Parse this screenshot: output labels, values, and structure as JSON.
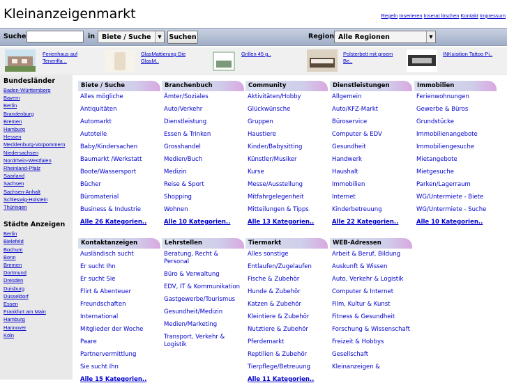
{
  "header": {
    "title": "Kleinanzeigenmarkt",
    "links": [
      "Regeln",
      "Inserieren",
      "Inserat löschen",
      "Kontakt",
      "Impressum"
    ]
  },
  "search": {
    "label": "Suche",
    "in_label": "in",
    "category_value": "Biete / Suche",
    "button": "Suchen",
    "region_label": "Region",
    "region_value": "Alle Regionen",
    "placeholder": ""
  },
  "ads": [
    {
      "title": "Ferienhaus auf Teneriffa ..",
      "thumb_color": "#a98c7a"
    },
    {
      "title": "GlasMattierung Die GlasM..",
      "thumb_color": "#e8dcc8"
    },
    {
      "title": "Grillen 45 g..",
      "thumb_color": "#7a9a7a"
    },
    {
      "title": "Polsterbett mit groem Be..",
      "thumb_color": "#5a4a3a"
    },
    {
      "title": "INKuisition Tattoo Pi..",
      "thumb_color": "#333333"
    }
  ],
  "sidebar": {
    "states_title": "Bundesländer",
    "states": [
      "Baden-Württemberg",
      "Bayern",
      "Berlin",
      "Brandenburg",
      "Bremen",
      "Hamburg",
      "Hessen",
      "Mecklenburg-Vorpommern",
      "Niedersachsen",
      "Nordrhein-Westfalen",
      "Rheinland-Pfalz",
      "Saarland",
      "Sachsen",
      "Sachsen-Anhalt",
      "Schleswig-Holstein",
      "Thüringen"
    ],
    "cities_title": "Städte Anzeigen",
    "cities": [
      "Berlin",
      "Bielefeld",
      "Bochum",
      "Bonn",
      "Bremen",
      "Dortmund",
      "Dresden",
      "Duisburg",
      "Düsseldorf",
      "Essen",
      "Frankfurt am Main",
      "Hamburg",
      "Hannover",
      "Köln"
    ]
  },
  "categories": [
    {
      "title": "Biete / Suche",
      "items": [
        "Alles mögliche",
        "Antiquitäten",
        "Automarkt",
        "Autoteile",
        "Baby/Kindersachen",
        "Baumarkt /Werkstatt",
        "Boote/Wassersport",
        "Bücher",
        "Büromaterial",
        "Business & Industrie"
      ],
      "all": "Alle 26 Kategorien.."
    },
    {
      "title": "Branchenbuch",
      "items": [
        "Ämter/Soziales",
        "Auto/Verkehr",
        "Dienstleistung",
        "Essen & Trinken",
        "Grosshandel",
        "Medien/Buch",
        "Medizin",
        "Reise & Sport",
        "Shopping",
        "Wohnen"
      ],
      "all": "Alle 10 Kategorien.."
    },
    {
      "title": "Community",
      "items": [
        "Aktivitäten/Hobby",
        "Glückwünsche",
        "Gruppen",
        "Haustiere",
        "Kinder/Babysitting",
        "Künstler/Musiker",
        "Kurse",
        "Messe/Ausstellung",
        "Mitfahrgelegenheit",
        "Mitteilungen & Tipps"
      ],
      "all": "Alle 13 Kategorien.."
    },
    {
      "title": "Dienstleistungen",
      "items": [
        "Allgemein",
        "Auto/KFZ-Markt",
        "Büroservice",
        "Computer & EDV",
        "Gesundheit",
        "Handwerk",
        "Haushalt",
        "Immobilien",
        "Internet",
        "Kinderbetreuung"
      ],
      "all": "Alle 22 Kategorien.."
    },
    {
      "title": "Immobilien",
      "items": [
        "Ferienwohnungen",
        "Gewerbe & Büros",
        "Grundstücke",
        "Immobilienangebote",
        "Immobiliengesuche",
        "Mietangebote",
        "Mietgesuche",
        "Parken/Lagerraum",
        "WG/Untermiete - Biete",
        "WG/Untermiete - Suche"
      ],
      "all": "Alle 10 Kategorien.."
    },
    {
      "title": "Kontaktanzeigen",
      "items": [
        "Ausländisch sucht",
        "Er sucht Ihn",
        "Er sucht Sie",
        "Flirt & Abenteuer",
        "Freundschaften",
        "International",
        "Mitglieder der Woche",
        "Paare",
        "Partnervermittlung",
        "Sie sucht Ihn"
      ],
      "all": "Alle 15 Kategorien.."
    },
    {
      "title": "Lehrstellen",
      "items": [
        "Beratung, Recht & Personal",
        "Büro & Verwaltung",
        "EDV, IT & Kommunikation",
        "Gastgewerbe/Tourismus",
        "Gesundheit/Medizin",
        "Medien/Marketing",
        "Transport, Verkehr & Logistik"
      ],
      "all": ""
    },
    {
      "title": "Tiermarkt",
      "items": [
        "Alles sonstige",
        "Entlaufen/Zugelaufen",
        "Fische & Zubehör",
        "Hunde & Zubehör",
        "Katzen & Zubehör",
        "Kleintiere & Zubehör",
        "Nutztiere & Zubehör",
        "Pferdemarkt",
        "Reptilien & Zubehör",
        "Tierpflege/Betreuung"
      ],
      "all": "Alle 11 Kategorien.."
    },
    {
      "title": "WEB-Adressen",
      "items": [
        "Arbeit & Beruf, Bildung",
        "Auskunft & Wissen",
        "Auto, Verkehr & Logistik",
        "Computer & Internet",
        "Film, Kultur & Kunst",
        "Fitness & Gesundheit",
        "Forschung & Wissenschaft",
        "Freizeit & Hobbys",
        "Gesellschaft",
        "Kleinanzeigen &"
      ],
      "all": ""
    }
  ]
}
